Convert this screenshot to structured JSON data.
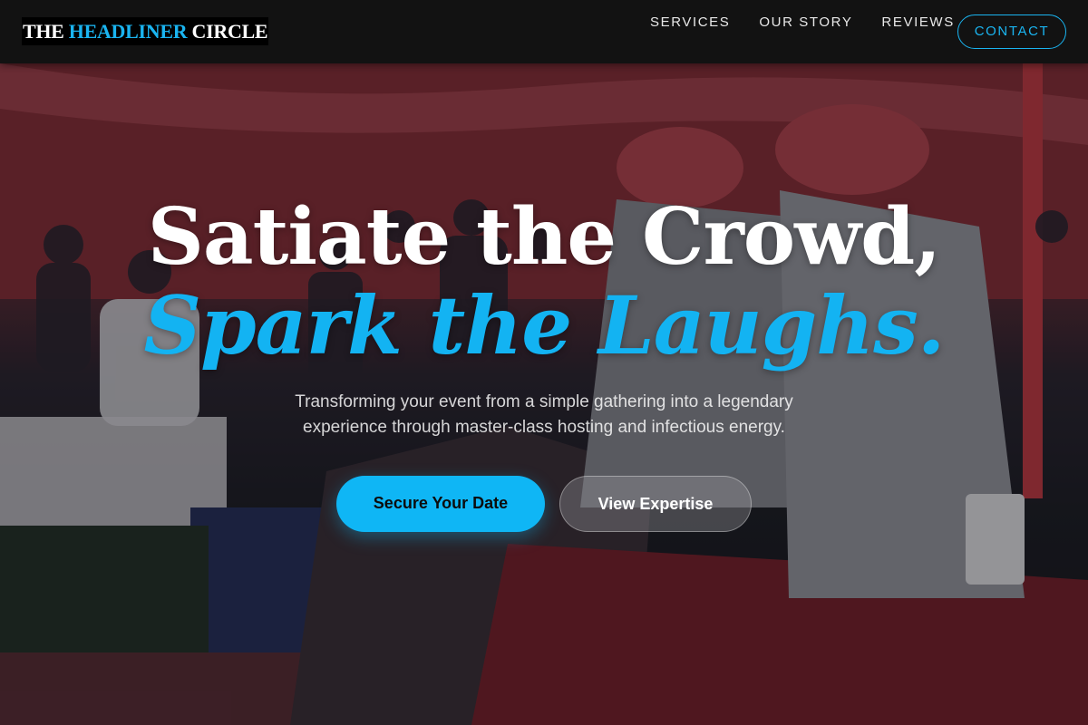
{
  "header": {
    "logo": {
      "part1": "THE ",
      "accent": "HEADLINER",
      "part2": " CIRCLE"
    },
    "nav": [
      "SERVICES",
      "OUR STORY",
      "REVIEWS"
    ],
    "contact_label": "CONTACT"
  },
  "hero": {
    "headline": "Satiate the Crowd,",
    "headline_accent": "Spark the Laughs.",
    "subtext": "Transforming your event from a simple gathering into a legendary experience through master-class hosting and infectious energy.",
    "primary_cta": "Secure Your Date",
    "secondary_cta": "View Expertise"
  },
  "theme": {
    "accent": "#13b3f2",
    "navbar_bg": "#121212"
  }
}
